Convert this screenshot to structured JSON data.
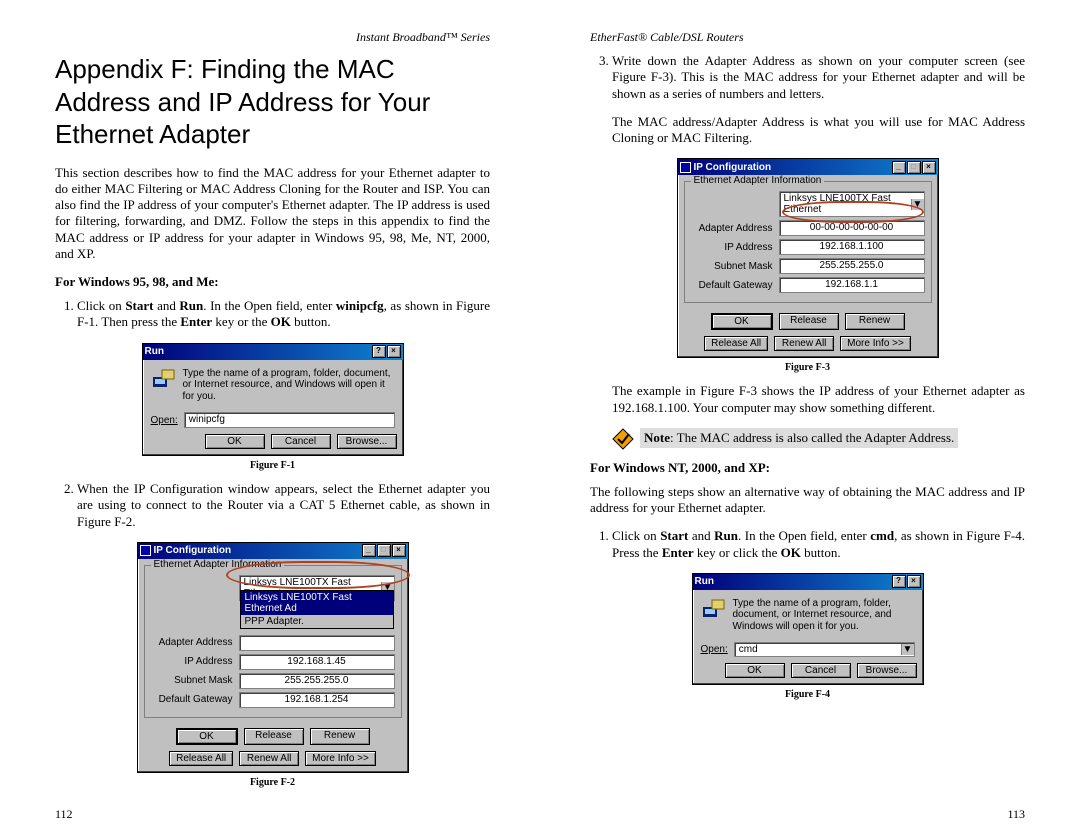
{
  "left": {
    "running_head": "Instant Broadband™ Series",
    "heading": "Appendix F: Finding the MAC Address and IP Address for Your Ethernet Adapter",
    "intro": "This section describes how to find the MAC address for your Ethernet adapter to do either MAC Filtering or MAC Address Cloning for the Router and ISP. You can also find the IP address of your computer's Ethernet adapter. The IP address is used for filtering, forwarding, and DMZ. Follow the steps in this appendix to find the MAC address or IP address for your adapter in Windows 95, 98, Me, NT, 2000, and XP.",
    "subhead": "For Windows 95, 98, and Me:",
    "step1_a": "Click on ",
    "step1_b_strong": "Start",
    "step1_c": " and ",
    "step1_d_strong": "Run",
    "step1_e": ". In the Open field, enter ",
    "step1_f_strong": "winipcfg",
    "step1_g": ", as shown in Figure F-1. Then press the ",
    "step1_h_strong": "Enter",
    "step1_i": " key or the ",
    "step1_j_strong": "OK",
    "step1_k": " button.",
    "fig1": "Figure F-1",
    "step2": "When the IP Configuration window appears, select the Ethernet adapter you are using to connect to the Router via a CAT 5 Ethernet cable, as shown in Figure F-2.",
    "fig2": "Figure F-2",
    "page_num": "112",
    "run_dialog": {
      "title": "Run",
      "text": "Type the name of a program, folder, document, or Internet resource, and Windows will open it for you.",
      "open_label": "Open:",
      "open_value": "winipcfg",
      "ok": "OK",
      "cancel": "Cancel",
      "browse": "Browse..."
    },
    "ipconfig_dialog": {
      "title": "IP Configuration",
      "group": "Ethernet Adapter Information",
      "dropdown_selected": "Linksys LNE100TX Fast Ethernet",
      "popup_hilite": "Linksys LNE100TX Fast Ethernet Ad",
      "popup_other": "PPP Adapter.",
      "field_labels": {
        "adapter": "Adapter Address",
        "ip": "IP Address",
        "mask": "Subnet Mask",
        "gw": "Default Gateway"
      },
      "values": {
        "adapter": "",
        "ip": "192.168.1.45",
        "mask": "255.255.255.0",
        "gw": "192.168.1.254"
      },
      "buttons": {
        "ok": "OK",
        "release": "Release",
        "renew": "Renew",
        "release_all": "Release All",
        "renew_all": "Renew All",
        "more": "More Info >>"
      }
    }
  },
  "right": {
    "running_head": "EtherFast® Cable/DSL Routers",
    "step3": "Write down the Adapter Address as shown on your computer screen (see Figure F-3). This is the MAC address for your Ethernet adapter and will be shown as a series of numbers and letters.",
    "para2": "The MAC address/Adapter Address is what you will use for MAC Address Cloning or MAC Filtering.",
    "fig3": "Figure F-3",
    "para3": "The example in Figure F-3 shows the IP address of your Ethernet adapter as 192.168.1.100. Your computer may show something different.",
    "note_a_strong": "Note",
    "note_b": ": The MAC address is also called the Adapter Address.",
    "subhead": "For Windows NT, 2000, and XP:",
    "para4": "The following steps show an alternative way of obtaining the MAC address and IP address for your Ethernet adapter.",
    "step1_a": "Click on ",
    "step1_b_strong": "Start",
    "step1_c": " and ",
    "step1_d_strong": "Run",
    "step1_e": ". In the Open field, enter ",
    "step1_f_strong": "cmd",
    "step1_g": ", as shown in Figure F-4. Press the ",
    "step1_h_strong": "Enter",
    "step1_i": " key or click the ",
    "step1_j_strong": "OK",
    "step1_k": " button.",
    "fig4": "Figure F-4",
    "page_num": "113",
    "ipconfig_dialog": {
      "title": "IP Configuration",
      "group": "Ethernet Adapter Information",
      "dropdown_selected": "Linksys LNE100TX Fast Ethernet",
      "field_labels": {
        "adapter": "Adapter Address",
        "ip": "IP Address",
        "mask": "Subnet Mask",
        "gw": "Default Gateway"
      },
      "values": {
        "adapter": "00-00-00-00-00-00",
        "ip": "192.168.1.100",
        "mask": "255.255.255.0",
        "gw": "192.168.1.1"
      },
      "buttons": {
        "ok": "OK",
        "release": "Release",
        "renew": "Renew",
        "release_all": "Release All",
        "renew_all": "Renew All",
        "more": "More Info >>"
      }
    },
    "run_dialog": {
      "title": "Run",
      "text": "Type the name of a program, folder, document, or Internet resource, and Windows will open it for you.",
      "open_label": "Open:",
      "open_value": "cmd",
      "ok": "OK",
      "cancel": "Cancel",
      "browse": "Browse..."
    }
  }
}
